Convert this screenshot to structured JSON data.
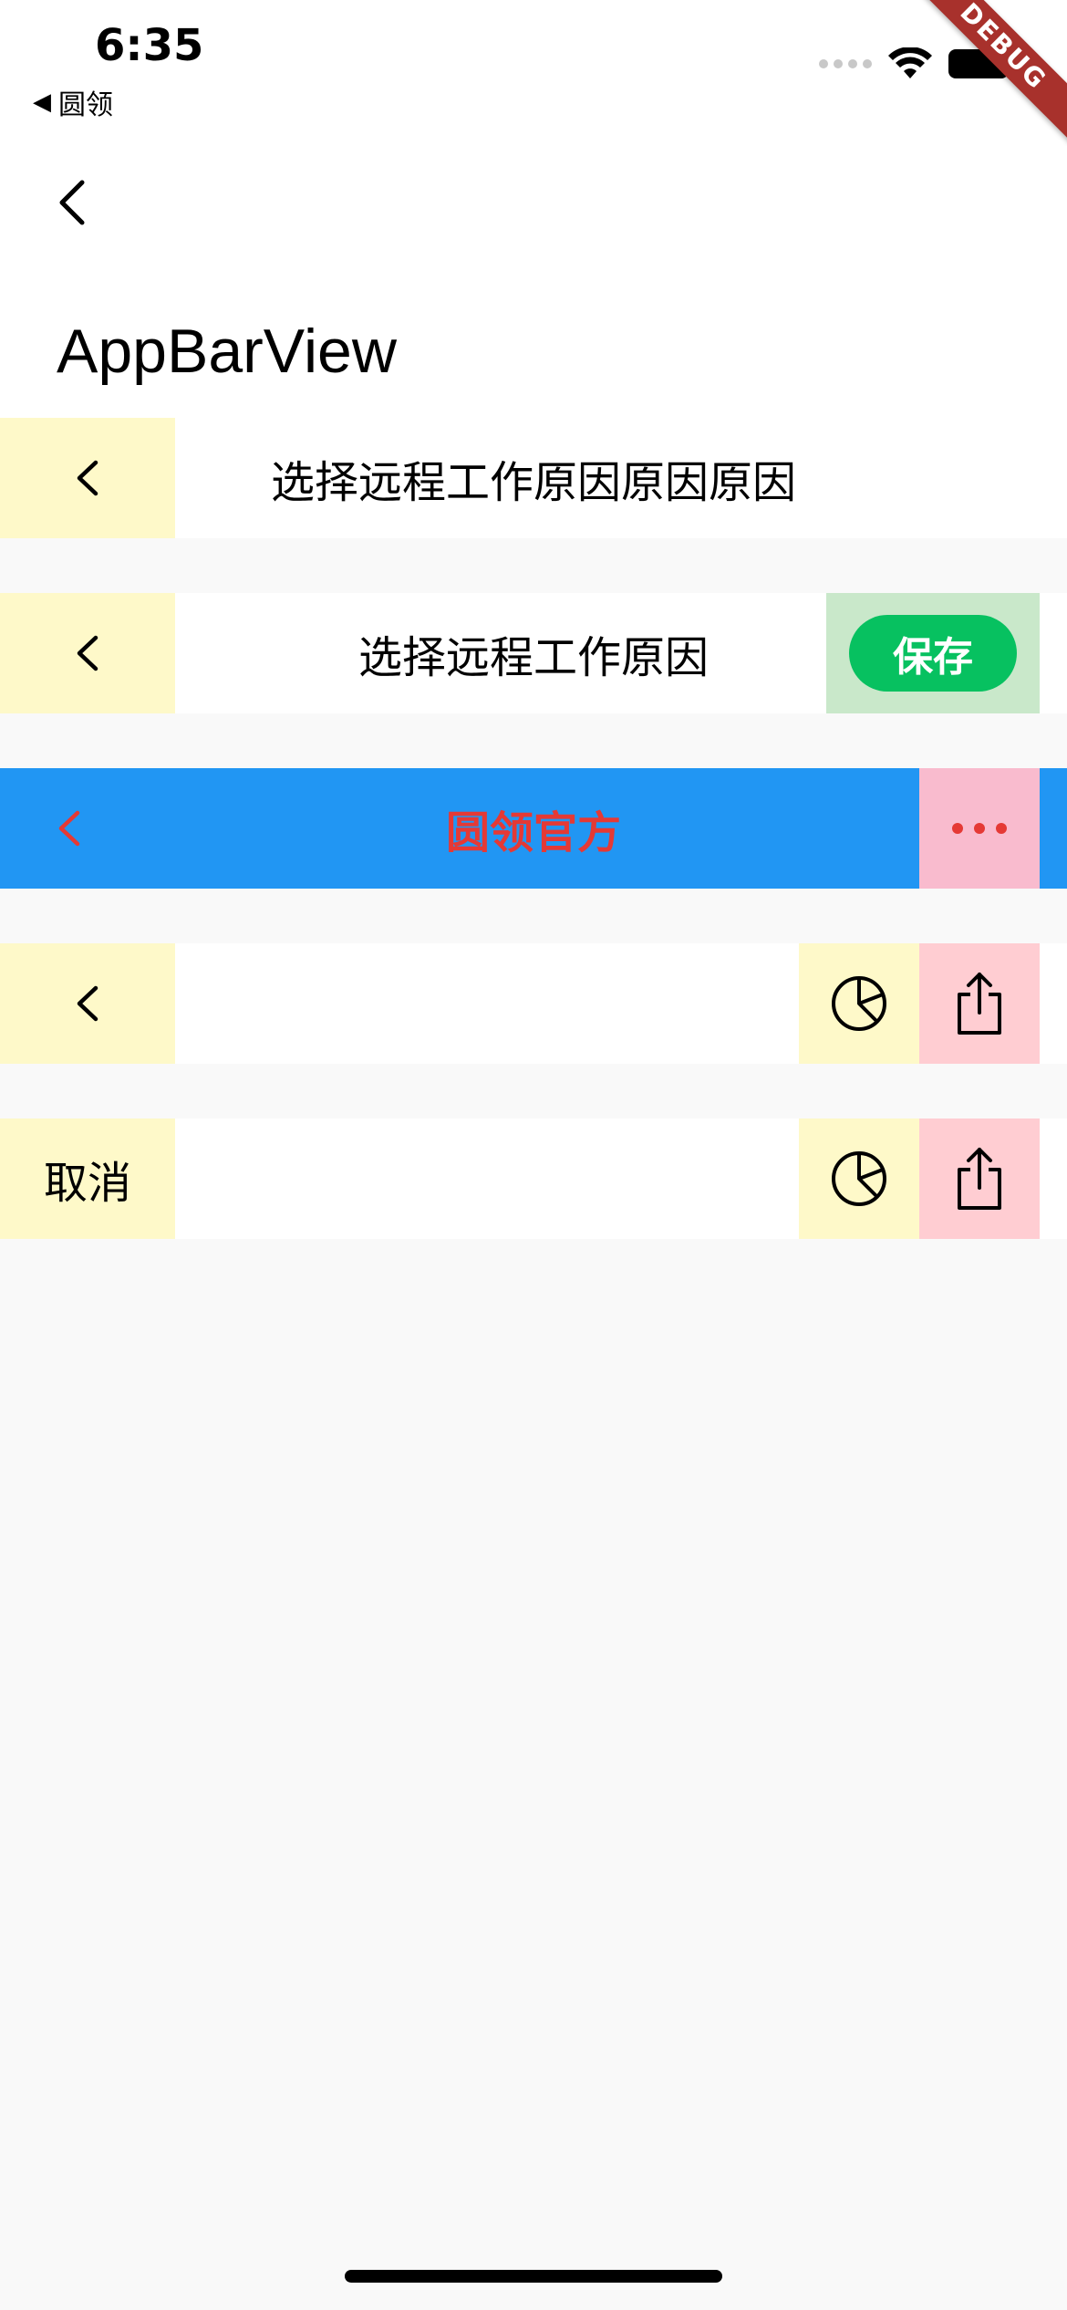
{
  "status_bar": {
    "time": "6:35",
    "back_app_label": "圆领",
    "back_icon": "triangle-left-icon"
  },
  "debug_banner": "DEBUG",
  "main_appbar": {
    "back_icon": "chevron-left-icon",
    "title": "AppBarView"
  },
  "bars": [
    {
      "title": "选择远程工作原因原因原因",
      "leading": "chevron-left-icon"
    },
    {
      "title": "选择远程工作原因",
      "leading": "chevron-left-icon",
      "action_label": "保存"
    },
    {
      "title": "圆领官方",
      "leading": "chevron-left-icon",
      "action_icon": "more-dots-icon"
    },
    {
      "title": "",
      "leading": "chevron-left-icon",
      "actions": [
        "pie-chart-icon",
        "share-icon"
      ]
    },
    {
      "title": "",
      "leading_label": "取消",
      "actions": [
        "pie-chart-icon",
        "share-icon"
      ]
    }
  ],
  "colors": {
    "leading_bg": "#fef9c9",
    "save_bg": "#c9e8ca",
    "save_button": "#07c160",
    "blue_bar": "#2196f3",
    "blue_title": "#e53935",
    "more_bg": "#f9bbce",
    "action_yellow": "#fef9c9",
    "action_pink": "#ffcdd2"
  }
}
